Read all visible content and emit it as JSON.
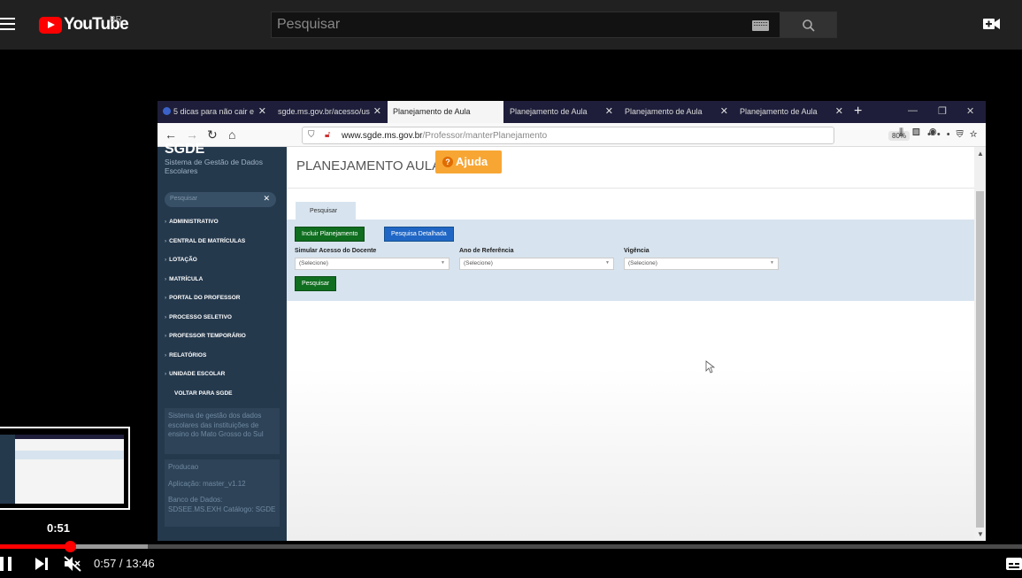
{
  "youtube": {
    "logo_text": "YouTube",
    "country": "BR",
    "search_placeholder": "Pesquisar"
  },
  "browser": {
    "tabs": [
      {
        "label": "5 dicas para não cair e"
      },
      {
        "label": "sgde.ms.gov.br/acesso/us"
      },
      {
        "label": "Planejamento de Aula"
      },
      {
        "label": "Planejamento de Aula"
      },
      {
        "label": "Planejamento de Aula"
      },
      {
        "label": "Planejamento de Aula"
      }
    ],
    "url_domain": "www.sgde.ms.gov.br",
    "url_path": "/Professor/manterPlanejamento",
    "zoom": "80%"
  },
  "sgde": {
    "logo": "SGDE",
    "subtitle": "Sistema de Gestão de Dados Escolares",
    "search_placeholder": "Pesquisar",
    "menu": [
      "ADMINISTRATIVO",
      "CENTRAL DE MATRÍCULAS",
      "LOTAÇÃO",
      "MATRÍCULA",
      "PORTAL DO PROFESSOR",
      "PROCESSO SELETIVO",
      "PROFESSOR TEMPORÁRIO",
      "RELATÓRIOS",
      "UNIDADE ESCOLAR"
    ],
    "back_link": "VOLTAR PARA SGDE",
    "about_text": "Sistema de gestão dos dados escolares das instituições de ensino do Mato Grosso do Sul",
    "env_label": "Producao",
    "app_version": "Aplicação: master_v1.12",
    "db_info": "Banco de Dados: SDSEE.MS.EXH Catálogo: SGDE",
    "page_title": "PLANEJAMENTO AULA",
    "help_label": "Ajuda",
    "tab_label": "Pesquisar",
    "btn_include": "Incluir Planejamento",
    "btn_detailed": "Pesquisa Detalhada",
    "fields": [
      {
        "label": "Simular Acesso do Docente",
        "value": "(Selecione)"
      },
      {
        "label": "Ano de Referência",
        "value": "(Selecione)"
      },
      {
        "label": "Vigência",
        "value": "(Selecione)"
      }
    ],
    "btn_search": "Pesquisar"
  },
  "player": {
    "preview_time": "0:51",
    "current_time": "0:57 / 13:46",
    "progress_fraction": 0.069,
    "buffer_fraction": 0.145
  }
}
